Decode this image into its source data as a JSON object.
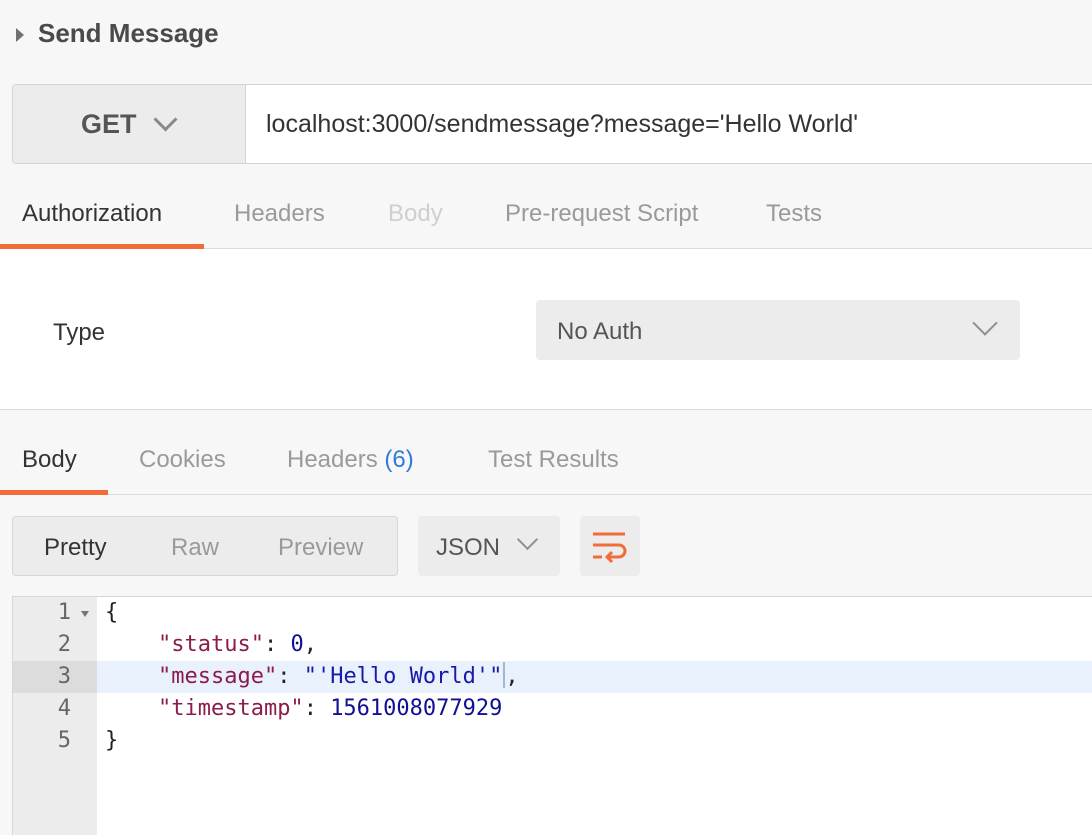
{
  "request": {
    "title": "Send Message",
    "method": "GET",
    "url": "localhost:3000/sendmessage?message='Hello World'"
  },
  "request_tabs": [
    {
      "label": "Authorization",
      "state": "active"
    },
    {
      "label": "Headers",
      "state": "normal"
    },
    {
      "label": "Body",
      "state": "disabled"
    },
    {
      "label": "Pre-request Script",
      "state": "normal"
    },
    {
      "label": "Tests",
      "state": "normal"
    }
  ],
  "auth": {
    "type_label": "Type",
    "selected": "No Auth"
  },
  "response_tabs": {
    "body": "Body",
    "cookies": "Cookies",
    "headers": "Headers",
    "headers_count": "(6)",
    "test_results": "Test Results"
  },
  "response_toolbar": {
    "view_modes": [
      "Pretty",
      "Raw",
      "Preview"
    ],
    "selected_view": "Pretty",
    "format": "JSON"
  },
  "response_body": {
    "line_numbers": [
      "1",
      "2",
      "3",
      "4",
      "5"
    ],
    "open_brace": "{",
    "close_brace": "}",
    "fields": [
      {
        "key": "\"status\"",
        "value": "0",
        "trail": ","
      },
      {
        "key": "\"message\"",
        "value": "\"'Hello World'\"",
        "trail": ","
      },
      {
        "key": "\"timestamp\"",
        "value": "1561008077929",
        "trail": ""
      }
    ],
    "highlighted_line": 3
  },
  "colors": {
    "accent": "#f26b3a",
    "count_blue": "#2f7bd6",
    "json_key": "#8b1c4c",
    "json_value": "#101093"
  },
  "icons": {
    "collapse": "caret-right-icon",
    "method_dropdown": "chevron-down-icon",
    "wrap": "wrap-lines-icon"
  }
}
